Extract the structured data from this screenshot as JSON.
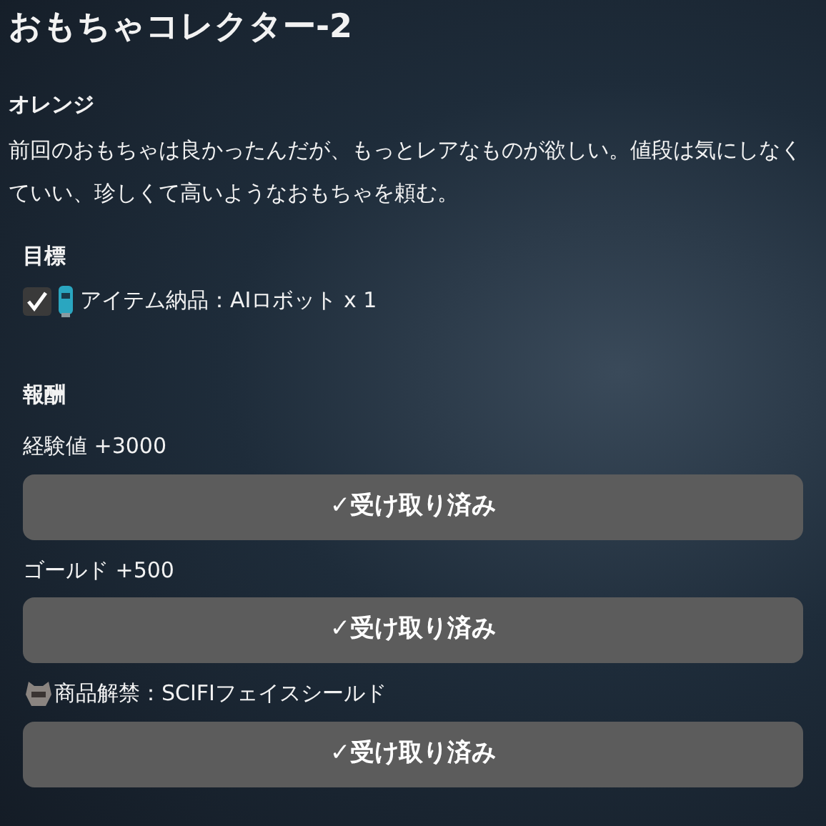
{
  "title": "おもちゃコレクター-2",
  "client": "オレンジ",
  "description": "前回のおもちゃは良かったんだが、もっとレアなものが欲しい。値段は気にしなくていい、珍しくて高いようなおもちゃを頼む。",
  "objectives": {
    "heading": "目標",
    "items": [
      {
        "text": "アイテム納品：AIロボット x 1",
        "checked": true
      }
    ]
  },
  "rewards": {
    "heading": "報酬",
    "items": [
      {
        "kind": "plain",
        "label": "経験値 +3000",
        "button": "✓受け取り済み",
        "claimed": true
      },
      {
        "kind": "plain",
        "label": "ゴールド +500",
        "button": "✓受け取り済み",
        "claimed": true
      },
      {
        "kind": "item",
        "label": "商品解禁：SCIFIフェイスシールド",
        "button": "✓受け取り済み",
        "claimed": true
      }
    ]
  }
}
